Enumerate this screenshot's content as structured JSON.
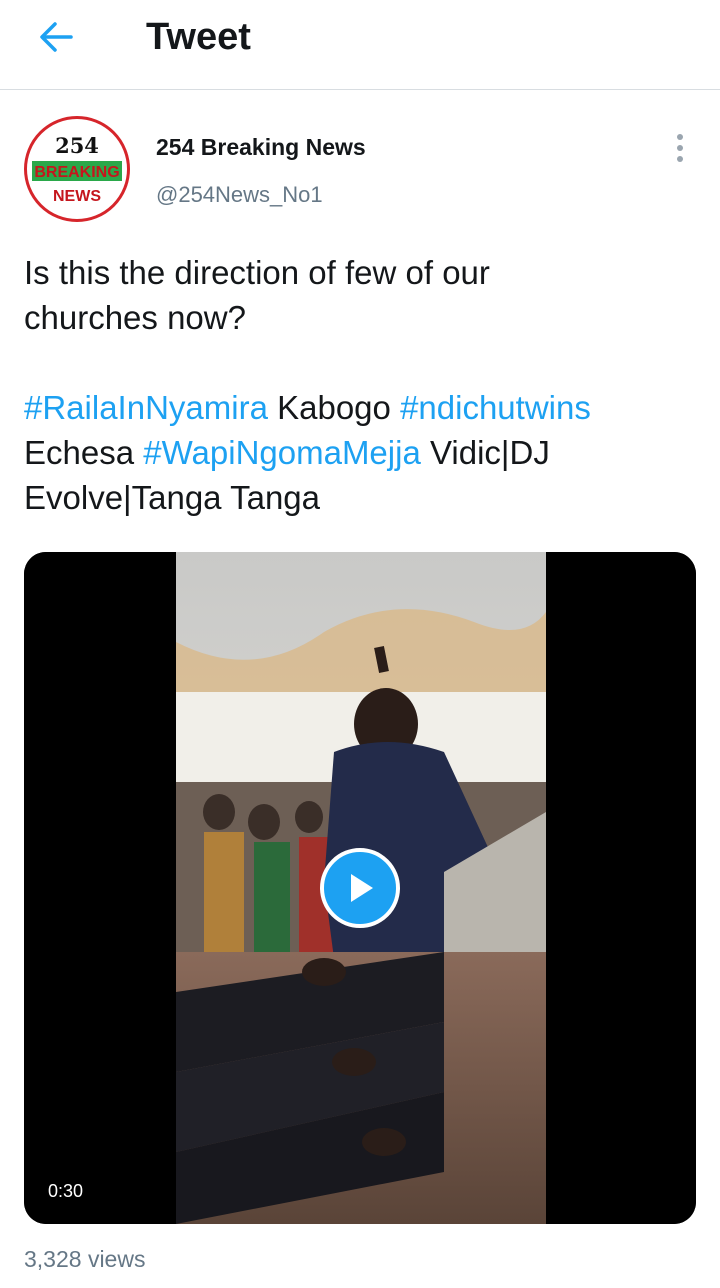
{
  "header": {
    "title": "Tweet",
    "back_icon": "arrow-left-icon",
    "accent_color": "#1da1f2"
  },
  "tweet": {
    "author": {
      "name": "254 Breaking News",
      "handle": "@254News_No1",
      "avatar_text": {
        "line1": "254",
        "line2": "BREAKING",
        "line3": "NEWS"
      }
    },
    "text": {
      "line1": "Is this the direction of few of our",
      "line2": "churches now?",
      "tags": {
        "t1": "#RailaInNyamira",
        "w1": " Kabogo ",
        "t2": "#ndichutwins",
        "w2": "Echesa ",
        "t3": "#WapiNgomaMejja",
        "w3": " Vidic|DJ",
        "w4": "Evolve|Tanga Tanga"
      }
    },
    "media": {
      "type": "video",
      "duration": "0:30",
      "play_icon": "play-icon"
    },
    "views": "3,328 views"
  }
}
